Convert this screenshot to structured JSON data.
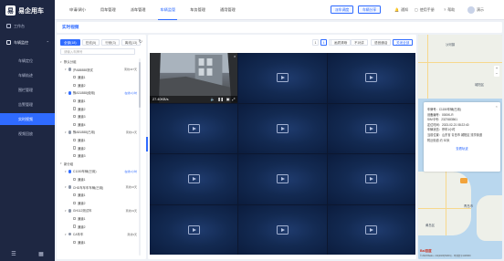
{
  "app": {
    "logo_mark": "易",
    "name": "易企用车"
  },
  "sidebar": {
    "items": [
      {
        "label": "工作台",
        "icon": "home-icon"
      },
      {
        "label": "车辆监控",
        "icon": "monitor-icon"
      },
      {
        "label": "车辆定位"
      },
      {
        "label": "车辆轨迹"
      },
      {
        "label": "围栏管理"
      },
      {
        "label": "告警管理"
      },
      {
        "label": "实时视频"
      },
      {
        "label": "视频回放"
      }
    ],
    "active_index": 6
  },
  "topbar": {
    "nav": [
      "申请/调小",
      "用车管理",
      "派车管理",
      "车辆监管",
      "车务管理",
      "通用管理"
    ],
    "active_index": 3,
    "btn_left": "派车调度",
    "btn_right": "车辆分享",
    "notice": "通知",
    "help": "使用手册",
    "help2": "帮助",
    "user": "演示"
  },
  "page": {
    "title": "实时视频"
  },
  "tree": {
    "tabs": [
      "全部(18)",
      "在线(5)",
      "行驶(3)",
      "离线(13)"
    ],
    "active_tab": 0,
    "search_placeholder": "请输入车牌号",
    "rows": [
      {
        "level": 0,
        "label": "默认分组",
        "kind": "group"
      },
      {
        "level": 1,
        "label": "沪A88888测试",
        "kind": "car",
        "status": "#8a94a6",
        "tag": "离线437天"
      },
      {
        "level": 2,
        "label": "通道1",
        "kind": "channel"
      },
      {
        "level": 2,
        "label": "通道2",
        "kind": "channel"
      },
      {
        "level": 1,
        "label": "豫A31888(使用)",
        "kind": "car",
        "status": "#2f6bff",
        "tag": "在线1小时",
        "tag_blue": true
      },
      {
        "level": 2,
        "label": "通道1",
        "kind": "channel"
      },
      {
        "level": 2,
        "label": "通道2",
        "kind": "channel"
      },
      {
        "level": 2,
        "label": "通道3",
        "kind": "channel"
      },
      {
        "level": 2,
        "label": "通道4",
        "kind": "channel"
      },
      {
        "level": 1,
        "label": "豫A81888(已用)",
        "kind": "car",
        "status": "#8a94a6",
        "tag": "离线11天"
      },
      {
        "level": 2,
        "label": "通道1",
        "kind": "channel"
      },
      {
        "level": 2,
        "label": "通道2",
        "kind": "channel"
      },
      {
        "level": 2,
        "label": "通道3",
        "kind": "channel"
      },
      {
        "level": 0,
        "label": "新分组",
        "kind": "group"
      },
      {
        "level": 1,
        "label": "C1150车辆(已用)",
        "kind": "car",
        "status": "#2f6bff",
        "tag": "在线1小时",
        "tag_blue": true
      },
      {
        "level": 2,
        "label": "通道1",
        "kind": "channel"
      },
      {
        "level": 1,
        "label": "CHD车车车车辆(已用)",
        "kind": "car",
        "status": "#8a94a6",
        "tag": "离线16天"
      },
      {
        "level": 2,
        "label": "通道1",
        "kind": "channel"
      },
      {
        "level": 2,
        "label": "通道2",
        "kind": "channel"
      },
      {
        "level": 1,
        "label": "GH112测试车",
        "kind": "car",
        "status": "#8a94a6",
        "tag": "离线19天"
      },
      {
        "level": 2,
        "label": "通道1",
        "kind": "channel"
      },
      {
        "level": 2,
        "label": "通道2",
        "kind": "channel"
      },
      {
        "level": 1,
        "label": "CA车车",
        "kind": "car",
        "status": "#8a94a6",
        "tag": "离线3天"
      },
      {
        "level": 2,
        "label": "通道1",
        "kind": "channel"
      }
    ]
  },
  "video": {
    "toolbar": [
      "1",
      "4",
      "9"
    ],
    "selects": [
      "画质清晰",
      "不对讲",
      "语音通话",
      "关闭全部"
    ],
    "live_speed": "27.40KB/s",
    "cells": 12,
    "live_cell": 0
  },
  "map": {
    "place_top": "沙河镇",
    "labels": [
      "青岛市",
      "黄岛区",
      "城阳区"
    ],
    "info": {
      "plate_k": "车牌号：",
      "plate_v": "C1150车辆(已用)",
      "dev_k": "设备编号：",
      "dev_v": "0000K-R",
      "sim_k": "SIM卡号：",
      "sim_v": "2327683561",
      "time_k": "定位时间：",
      "time_v": "2023-02-21 08:22:40",
      "state_k": "车辆状态：",
      "state_v": "停车1小时",
      "addr_k": "当前位置：",
      "addr_v": "山东省 青岛市 城阳区 流亭街道",
      "addr2": "附近街道 约 52米"
    },
    "track_link": "查看轨迹",
    "brand": "Bai百度",
    "copyright": "© 2023 Baidu - GS(2023)5409号 - 甲测资字1100930",
    "accent": "#2f6bff"
  }
}
